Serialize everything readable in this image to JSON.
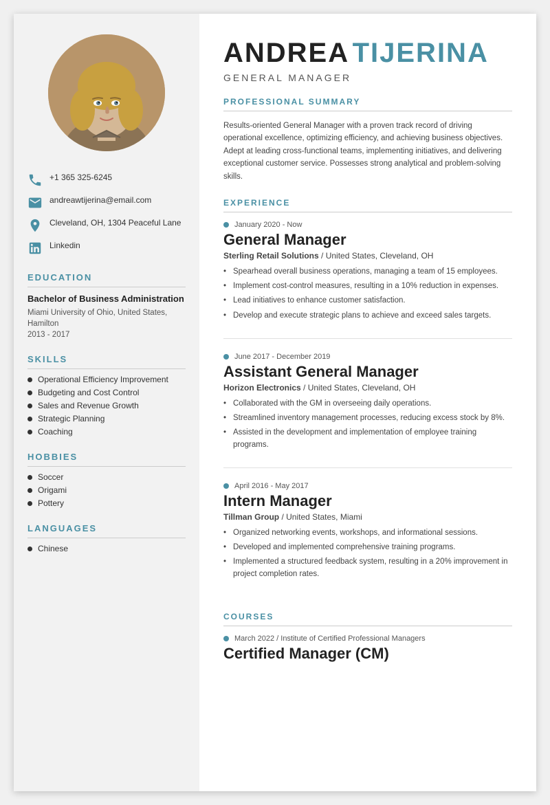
{
  "person": {
    "first_name": "ANDREA",
    "last_name": "TIJERINA",
    "job_title": "GENERAL MANAGER"
  },
  "contact": {
    "phone": "+1 365 325-6245",
    "email": "andreawtijerina@email.com",
    "address": "Cleveland, OH, 1304 Peaceful Lane",
    "linkedin": "Linkedin"
  },
  "education": {
    "degree": "Bachelor of Business Administration",
    "school": "Miami University of Ohio, United States, Hamilton",
    "years": "2013 - 2017"
  },
  "skills": [
    "Operational Efficiency Improvement",
    "Budgeting and Cost Control",
    "Sales and Revenue Growth",
    "Strategic Planning",
    "Coaching"
  ],
  "hobbies": [
    "Soccer",
    "Origami",
    "Pottery"
  ],
  "languages": [
    "Chinese"
  ],
  "summary": "Results-oriented General Manager with a proven track record of driving operational excellence, optimizing efficiency, and achieving business objectives. Adept at leading cross-functional teams, implementing initiatives, and delivering exceptional customer service. Possesses strong analytical and problem-solving skills.",
  "experience": [
    {
      "date": "January 2020 - Now",
      "role": "General Manager",
      "company": "Sterling Retail Solutions",
      "location": "United States, Cleveland, OH",
      "bullets": [
        "Spearhead overall business operations, managing a team of 15 employees.",
        "Implement cost-control measures, resulting in a 10% reduction in expenses.",
        "Lead initiatives to enhance customer satisfaction.",
        "Develop and execute strategic plans to achieve and exceed sales targets."
      ]
    },
    {
      "date": "June 2017 - December 2019",
      "role": "Assistant General Manager",
      "company": "Horizon Electronics",
      "location": "United States, Cleveland, OH",
      "bullets": [
        "Collaborated with the GM in overseeing daily operations.",
        "Streamlined inventory management processes, reducing excess stock by 8%.",
        "Assisted in the development and implementation of employee training programs."
      ]
    },
    {
      "date": "April 2016 - May 2017",
      "role": "Intern Manager",
      "company": "Tillman Group",
      "location": "United States, Miami",
      "bullets": [
        "Organized networking events, workshops, and informational sessions.",
        "Developed and implemented comprehensive training programs.",
        "Implemented a structured feedback system, resulting in a 20% improvement in project completion rates."
      ]
    }
  ],
  "courses": [
    {
      "date": "March 2022",
      "institution": "Institute of Certified Professional Managers",
      "name": "Certified Manager (CM)"
    }
  ],
  "sections": {
    "education_label": "EDUCATION",
    "skills_label": "SKILLS",
    "hobbies_label": "HOBBIES",
    "languages_label": "LANGUAGES",
    "summary_label": "PROFESSIONAL SUMMARY",
    "experience_label": "EXPERIENCE",
    "courses_label": "COURSES"
  }
}
